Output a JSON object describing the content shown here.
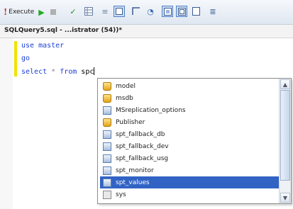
{
  "toolbar": {
    "execute_label": "Execute",
    "icons": [
      "execute-icon",
      "play-icon",
      "stop-icon",
      "parse-check-icon",
      "results-grid-icon",
      "results-text-icon",
      "display-plan-icon",
      "query-options-icon",
      "intellisense-icon",
      "include-plan-icon",
      "client-stats-icon",
      "results-file-icon",
      "comment-icon"
    ]
  },
  "editor": {
    "tab_title": "SQLQuery5.sql - ...istrator (54))*",
    "lines": {
      "line1_keyword": "use",
      "line1_rest": " master",
      "line2_keyword": "go",
      "line3_keyword": "select",
      "line3_star": " * ",
      "line3_from": "from",
      "line3_typed": " spc"
    }
  },
  "autocomplete": {
    "items": [
      {
        "label": "model",
        "icon": "database-icon",
        "selected": false
      },
      {
        "label": "msdb",
        "icon": "database-icon",
        "selected": false
      },
      {
        "label": "MSreplication_options",
        "icon": "table-icon",
        "selected": false
      },
      {
        "label": "Publisher",
        "icon": "database-icon",
        "selected": false
      },
      {
        "label": "spt_fallback_db",
        "icon": "table-icon",
        "selected": false
      },
      {
        "label": "spt_fallback_dev",
        "icon": "table-icon",
        "selected": false
      },
      {
        "label": "spt_fallback_usg",
        "icon": "table-icon",
        "selected": false
      },
      {
        "label": "spt_monitor",
        "icon": "table-icon",
        "selected": false
      },
      {
        "label": "spt_values",
        "icon": "table-icon",
        "selected": true
      },
      {
        "label": "sys",
        "icon": "schema-icon",
        "selected": false
      }
    ]
  },
  "colors": {
    "keyword": "#1c3fd0",
    "selection": "#3163c5",
    "change_marker": "#f1e300",
    "execute_icon": "#d02020",
    "play_icon": "#22aa22"
  }
}
